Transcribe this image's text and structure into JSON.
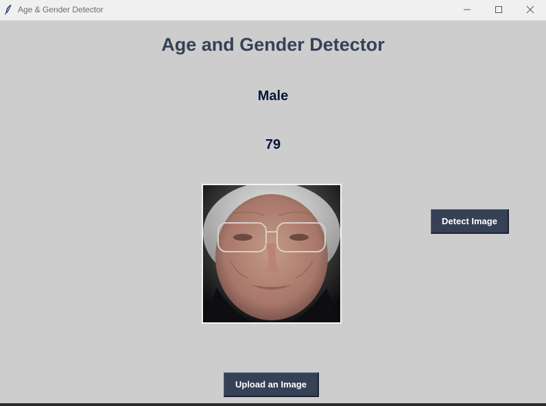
{
  "window": {
    "title": "Age & Gender Detector",
    "icons": {
      "app": "feather-icon",
      "minimize": "minimize-icon",
      "maximize": "maximize-icon",
      "close": "close-icon"
    }
  },
  "main": {
    "heading": "Age and Gender Detector",
    "gender_label": "Male",
    "age_label": "79",
    "detect_button_label": "Detect Image",
    "upload_button_label": "Upload an Image"
  },
  "colors": {
    "background": "#cdcdcd",
    "heading": "#364156",
    "result_text": "#011638",
    "button_bg": "#364156",
    "button_text": "#ffffff"
  }
}
